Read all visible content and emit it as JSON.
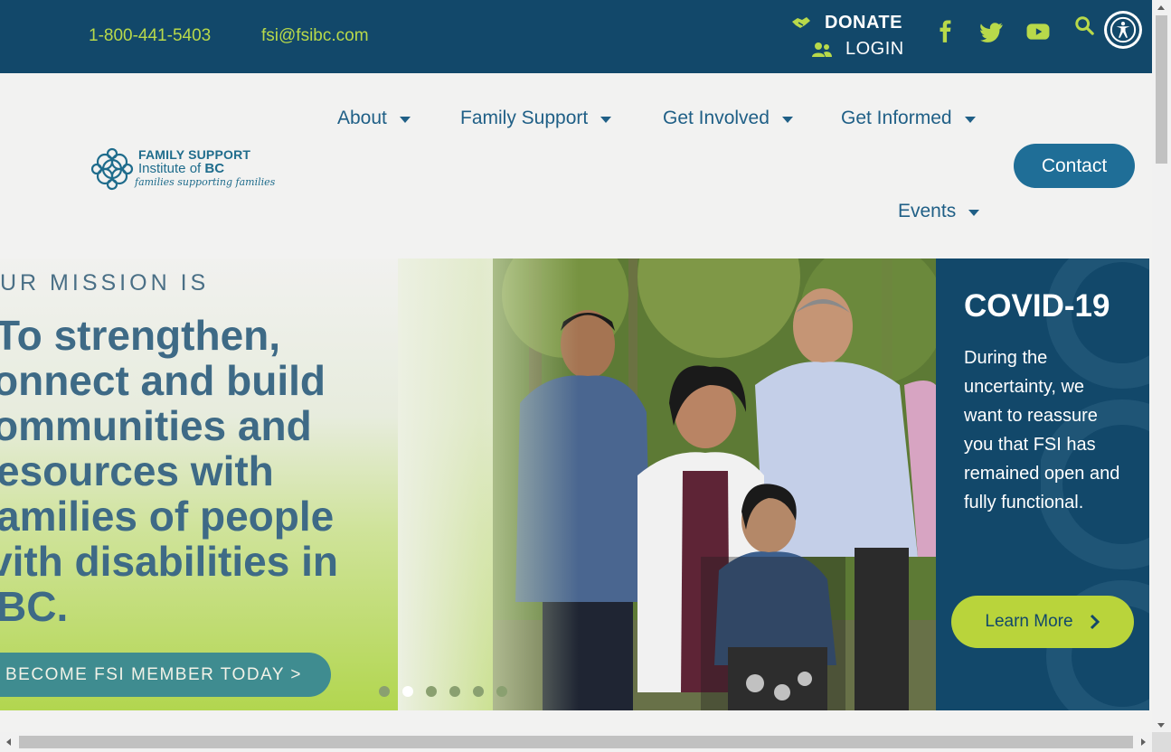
{
  "topbar": {
    "phone": "1-800-441-5403",
    "email": "fsi@fsibc.com",
    "donate_label": "DONATE",
    "login_label": "LOGIN",
    "social_icons": [
      "facebook-icon",
      "twitter-icon",
      "youtube-icon"
    ],
    "search_icon": "search-icon",
    "accessibility_icon": "accessibility-icon"
  },
  "logo": {
    "line1": "FAMILY SUPPORT",
    "line2a": "Institute of ",
    "line2b": "BC",
    "tagline": "families supporting families"
  },
  "nav": {
    "items": [
      {
        "label": "About"
      },
      {
        "label": "Family Support"
      },
      {
        "label": "Get Involved"
      },
      {
        "label": "Get Informed"
      },
      {
        "label": "Events"
      }
    ],
    "contact_label": "Contact"
  },
  "hero": {
    "mission": "UR MISSION IS",
    "headline": "To strengthen, connect and build communities and resources with families of people with disabilities in BC.",
    "headline_lines": [
      "To strengthen,",
      "onnect and build",
      "ommunities and",
      "esources with",
      "amilies of people",
      "vith disabilities in",
      "BC."
    ],
    "member_button": "BECOME FSI MEMBER TODAY >",
    "slider_count": 6,
    "slider_active": 2
  },
  "covid": {
    "title": "COVID-19",
    "body": "During the uncertainty, we want to reassure you that FSI has remained open and fully functional.",
    "button": "Learn More"
  },
  "colors": {
    "topbar_bg": "#12486a",
    "accent_green": "#b8d94a",
    "nav_text": "#1f5f86",
    "contact_bg": "#1f6e97",
    "learn_bg": "#b9d43b"
  }
}
